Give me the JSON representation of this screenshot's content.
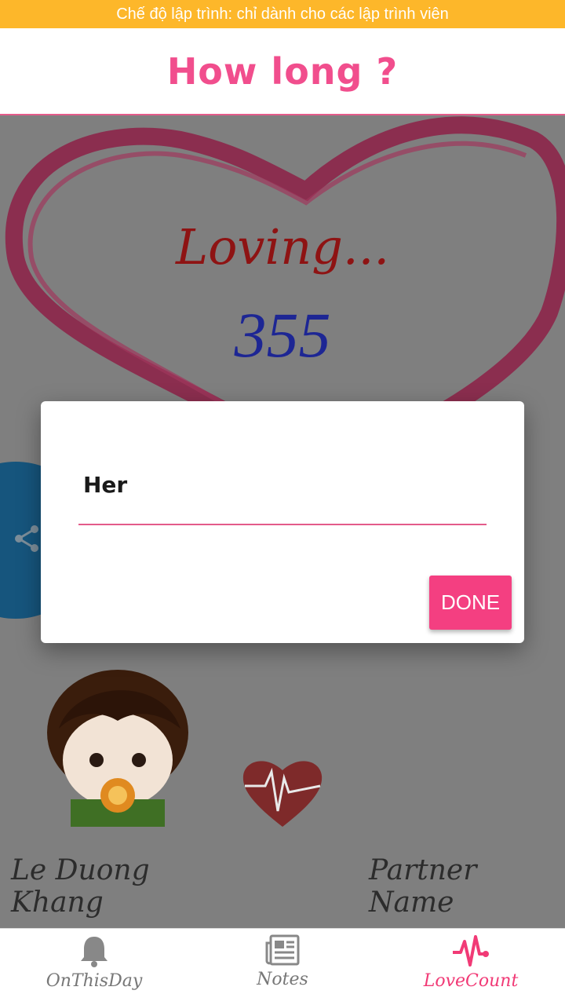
{
  "dev_banner": "Chế độ lập trình: chỉ dành cho các lập trình viên",
  "app_bar": {
    "title": "How long ?"
  },
  "main": {
    "loving_text": "Loving...",
    "day_count": "355",
    "person_left": "Le Duong Khang",
    "person_right": "Partner Name"
  },
  "dialog": {
    "input_value": "Her",
    "done_label": "DONE"
  },
  "bottom_nav": {
    "items": [
      {
        "label": "OnThisDay",
        "icon": "bell-icon"
      },
      {
        "label": "Notes",
        "icon": "newspaper-icon"
      },
      {
        "label": "LoveCount",
        "icon": "heartbeat-icon",
        "active": true
      }
    ]
  },
  "colors": {
    "banner": "#fdb72a",
    "accent": "#f43f81",
    "loving": "#8e1313",
    "count": "#1d2694"
  }
}
